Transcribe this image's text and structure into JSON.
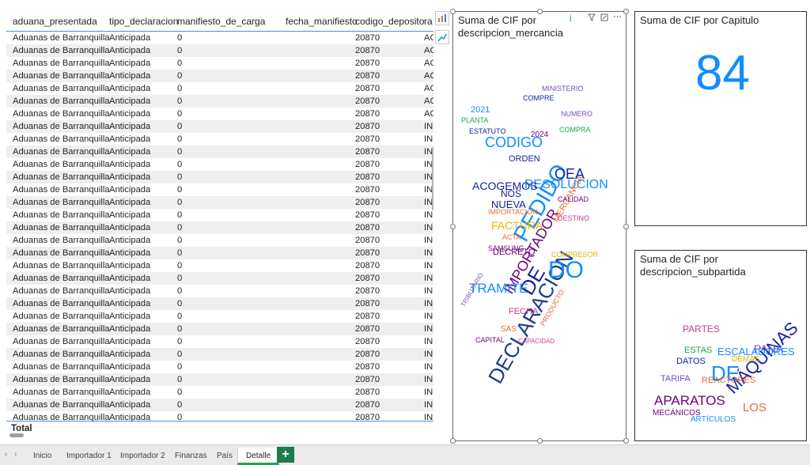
{
  "table": {
    "columns": [
      "aduana_presentada",
      "tipo_declaracion",
      "manifiesto_de_carga",
      "fecha_manifiesto",
      "codigo_deposito",
      "ra"
    ],
    "rows": [
      [
        "Aduanas de Barranquilla",
        "Anticipada",
        "0",
        "",
        "20870",
        "AC"
      ],
      [
        "Aduanas de Barranquilla",
        "Anticipada",
        "0",
        "",
        "20870",
        "AC"
      ],
      [
        "Aduanas de Barranquilla",
        "Anticipada",
        "0",
        "",
        "20870",
        "AC"
      ],
      [
        "Aduanas de Barranquilla",
        "Anticipada",
        "0",
        "",
        "20870",
        "AC"
      ],
      [
        "Aduanas de Barranquilla",
        "Anticipada",
        "0",
        "",
        "20870",
        "AC"
      ],
      [
        "Aduanas de Barranquilla",
        "Anticipada",
        "0",
        "",
        "20870",
        "AC"
      ],
      [
        "Aduanas de Barranquilla",
        "Anticipada",
        "0",
        "",
        "20870",
        "AC"
      ],
      [
        "Aduanas de Barranquilla",
        "Anticipada",
        "0",
        "",
        "20870",
        "IN"
      ],
      [
        "Aduanas de Barranquilla",
        "Anticipada",
        "0",
        "",
        "20870",
        "IN"
      ],
      [
        "Aduanas de Barranquilla",
        "Anticipada",
        "0",
        "",
        "20870",
        "IN"
      ],
      [
        "Aduanas de Barranquilla",
        "Anticipada",
        "0",
        "",
        "20870",
        "IN"
      ],
      [
        "Aduanas de Barranquilla",
        "Anticipada",
        "0",
        "",
        "20870",
        "IN"
      ],
      [
        "Aduanas de Barranquilla",
        "Anticipada",
        "0",
        "",
        "20870",
        "IN"
      ],
      [
        "Aduanas de Barranquilla",
        "Anticipada",
        "0",
        "",
        "20870",
        "IN"
      ],
      [
        "Aduanas de Barranquilla",
        "Anticipada",
        "0",
        "",
        "20870",
        "IN"
      ],
      [
        "Aduanas de Barranquilla",
        "Anticipada",
        "0",
        "",
        "20870",
        "IN"
      ],
      [
        "Aduanas de Barranquilla",
        "Anticipada",
        "0",
        "",
        "20870",
        "IN"
      ],
      [
        "Aduanas de Barranquilla",
        "Anticipada",
        "0",
        "",
        "20870",
        "IN"
      ],
      [
        "Aduanas de Barranquilla",
        "Anticipada",
        "0",
        "",
        "20870",
        "IN"
      ],
      [
        "Aduanas de Barranquilla",
        "Anticipada",
        "0",
        "",
        "20870",
        "IN"
      ],
      [
        "Aduanas de Barranquilla",
        "Anticipada",
        "0",
        "",
        "20870",
        "IN"
      ],
      [
        "Aduanas de Barranquilla",
        "Anticipada",
        "0",
        "",
        "20870",
        "IN"
      ],
      [
        "Aduanas de Barranquilla",
        "Anticipada",
        "0",
        "",
        "20870",
        "IN"
      ],
      [
        "Aduanas de Barranquilla",
        "Anticipada",
        "0",
        "",
        "20870",
        "IN"
      ],
      [
        "Aduanas de Barranquilla",
        "Anticipada",
        "0",
        "",
        "20870",
        "IN"
      ],
      [
        "Aduanas de Barranquilla",
        "Anticipada",
        "0",
        "",
        "20870",
        "IN"
      ],
      [
        "Aduanas de Barranquilla",
        "Anticipada",
        "0",
        "",
        "20870",
        "IN"
      ],
      [
        "Aduanas de Barranquilla",
        "Anticipada",
        "0",
        "",
        "20870",
        "IN"
      ],
      [
        "Aduanas de Barranquilla",
        "Anticipada",
        "0",
        "",
        "20870",
        "IN"
      ],
      [
        "Aduanas de Barranquilla",
        "Anticipada",
        "0",
        "",
        "20870",
        "IN"
      ],
      [
        "Aduanas de Barranquilla",
        "Anticipada",
        "0",
        "",
        "20870",
        "IN"
      ]
    ],
    "total_label": "Total"
  },
  "wordcloud_mercancia": {
    "title": "Suma de CIF por descripcion_mercancia",
    "info_icon": "i",
    "words": [
      {
        "t": "DECLARACION",
        "c": "#1a3c8c"
      },
      {
        "t": "PEDIDO",
        "c": "#118dff"
      },
      {
        "t": "DO",
        "c": "#118dff"
      },
      {
        "t": "DE",
        "c": "#12239e"
      },
      {
        "t": "IMPORTADOR",
        "c": "#6b007b"
      },
      {
        "t": "TRAMITE",
        "c": "#118dff"
      },
      {
        "t": "CODIGO",
        "c": "#118dff"
      },
      {
        "t": "RESOLUCION",
        "c": "#118dff"
      },
      {
        "t": "FACTURA",
        "c": "#e6b800"
      },
      {
        "t": "OEA",
        "c": "#12239e"
      },
      {
        "t": "ACOGEMOS",
        "c": "#12239e"
      },
      {
        "t": "NUEVA",
        "c": "#12239e"
      },
      {
        "t": "MERCANCIA",
        "c": "#e66c37"
      },
      {
        "t": "NOS",
        "c": "#12239e"
      },
      {
        "t": "FECHA",
        "c": "#c83d95"
      },
      {
        "t": "DECRETO",
        "c": "#6b007b"
      },
      {
        "t": "SAS",
        "c": "#e66c37"
      },
      {
        "t": "MINISTERIO",
        "c": "#744ec2"
      },
      {
        "t": "IMPORTACION",
        "c": "#e66c37"
      },
      {
        "t": "COMPRA",
        "c": "#1aab40"
      },
      {
        "t": "CAPITAL",
        "c": "#6b007b"
      },
      {
        "t": "ORDEN",
        "c": "#12239e"
      },
      {
        "t": "2024",
        "c": "#6b007b"
      },
      {
        "t": "2021",
        "c": "#118dff"
      },
      {
        "t": "PRODUCTO",
        "c": "#e66c37"
      },
      {
        "t": "COMPRESOR",
        "c": "#d9b300"
      },
      {
        "t": "TRIBUTARIO",
        "c": "#744ec2"
      },
      {
        "t": "DESTINO",
        "c": "#c83d95"
      },
      {
        "t": "SAMSUNG",
        "c": "#6b007b"
      },
      {
        "t": "PLANTA",
        "c": "#1aab40"
      },
      {
        "t": "ESTATUTO",
        "c": "#12239e"
      },
      {
        "t": "CALIDAD",
        "c": "#6b007b"
      },
      {
        "t": "NUMERO",
        "c": "#744ec2"
      },
      {
        "t": "COMPRE",
        "c": "#12239e"
      },
      {
        "t": "ACTA",
        "c": "#e66c37"
      },
      {
        "t": "CAPACIDAD",
        "c": "#c83d95"
      }
    ]
  },
  "card_capitulo": {
    "title": "Suma de CIF por Capitulo",
    "value": "84"
  },
  "wordcloud_subpartida": {
    "title": "Suma de CIF por descripcion_subpartida",
    "words": [
      {
        "t": "MÁQUINAS",
        "c": "#12239e"
      },
      {
        "t": "DE",
        "c": "#118dff"
      },
      {
        "t": "APARATOS",
        "c": "#6b007b"
      },
      {
        "t": "LOS",
        "c": "#e66c37"
      },
      {
        "t": "PARA",
        "c": "#744ec2"
      },
      {
        "t": "ESCALADORES",
        "c": "#118dff"
      },
      {
        "t": "PARTES",
        "c": "#c83d95"
      },
      {
        "t": "DATOS",
        "c": "#12239e"
      },
      {
        "t": "ESTAS",
        "c": "#1aab40"
      },
      {
        "t": "REACTORES",
        "c": "#e66c37"
      },
      {
        "t": "TARIFA",
        "c": "#744ec2"
      },
      {
        "t": "MECÁNICOS",
        "c": "#6b007b"
      },
      {
        "t": "DEMÁS",
        "c": "#d9b300"
      },
      {
        "t": "ARTÍCULOS",
        "c": "#118dff"
      }
    ]
  },
  "tabs": [
    "Inicio",
    "Importador 1",
    "Importador 2",
    "Finanzas",
    "País",
    "Detalle"
  ],
  "active_tab": "Detalle",
  "add_tab_label": "+"
}
